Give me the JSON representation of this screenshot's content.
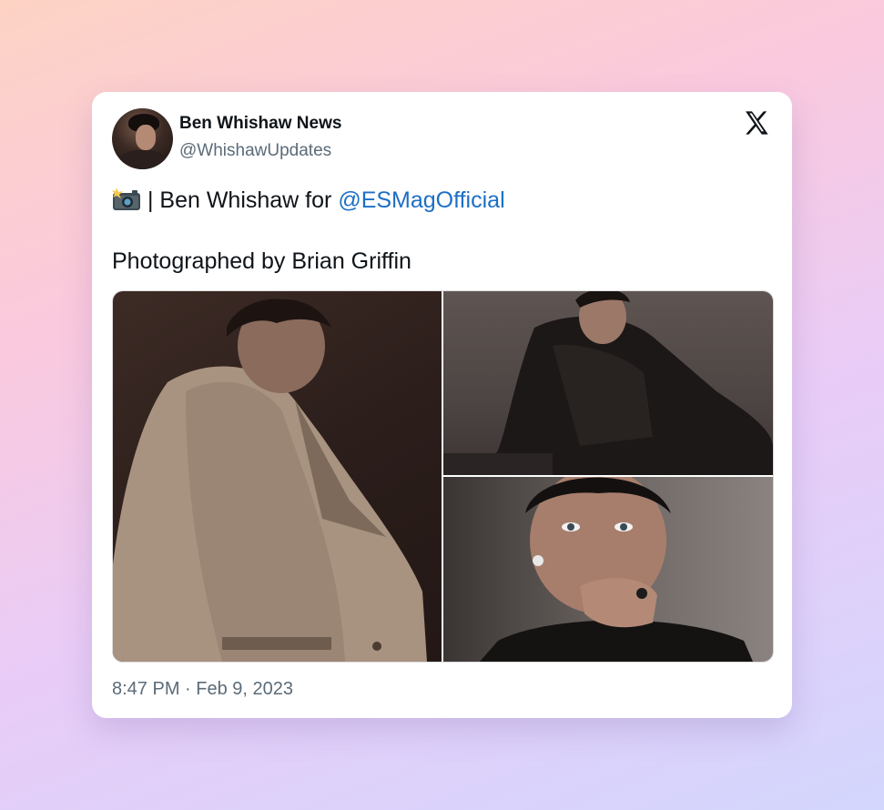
{
  "tweet": {
    "author_name": "Ben Whishaw News",
    "author_handle": "@WhishawUpdates",
    "text_prefix": "| Ben Whishaw for ",
    "mention": "@ESMagOfficial",
    "text_line2": "Photographed by Brian Griffin",
    "emoji_icon": "camera-with-flash-icon",
    "timestamp": "8:47 PM · Feb 9, 2023"
  },
  "media": [
    {
      "name": "photo-trench-coat"
    },
    {
      "name": "photo-leather-coat"
    },
    {
      "name": "photo-closeup-hand"
    }
  ],
  "colors": {
    "mention": "#1d6fc4",
    "secondary_text": "#5b6b78",
    "primary_text": "#0f1419"
  }
}
